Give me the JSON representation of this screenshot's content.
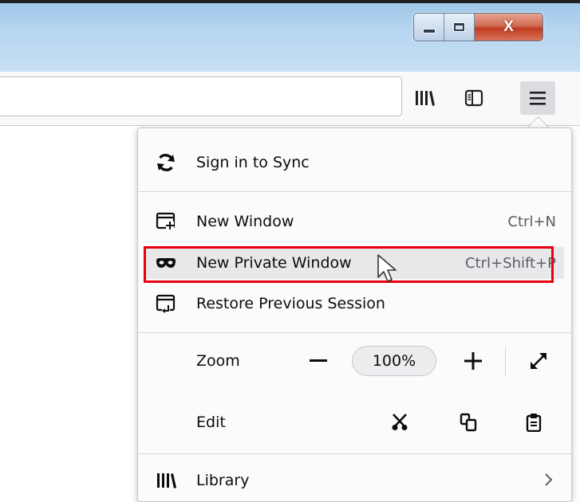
{
  "window": {
    "close_label": "X"
  },
  "menu": {
    "sign_in": "Sign in to Sync",
    "new_window": {
      "label": "New Window",
      "shortcut": "Ctrl+N"
    },
    "new_private_window": {
      "label": "New Private Window",
      "shortcut": "Ctrl+Shift+P"
    },
    "restore_session": "Restore Previous Session",
    "zoom": {
      "label": "Zoom",
      "value": "100%"
    },
    "edit": {
      "label": "Edit"
    },
    "library": "Library"
  },
  "colors": {
    "highlight_box": "#e8000e",
    "close_button": "#c23b1f"
  },
  "icons": {
    "toolbar": [
      "library-icon",
      "sidebar-icon",
      "hamburger-menu-icon"
    ],
    "menu": [
      "sync-icon",
      "new-window-icon",
      "private-mask-icon",
      "restore-session-icon",
      "cut-icon",
      "copy-icon",
      "paste-icon",
      "library-icon",
      "chevron-right-icon"
    ]
  }
}
